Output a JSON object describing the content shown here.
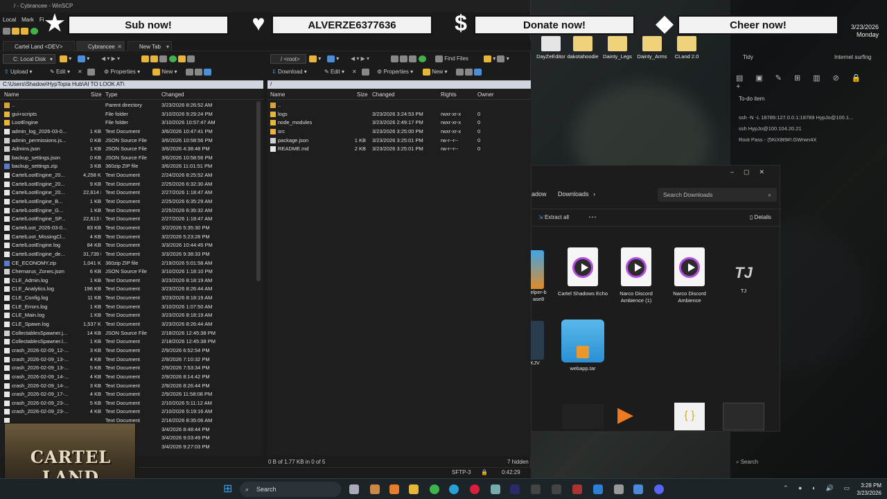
{
  "winscp": {
    "title": "/ - Cybrancee - WinSCP",
    "menu": [
      "Local",
      "Mark",
      "Fi"
    ],
    "tabs": [
      {
        "label": "Cartel Land <DEV>"
      },
      {
        "label": "Cybrancee"
      },
      {
        "label": "New Tab"
      }
    ],
    "local": {
      "drive": "C: Local Disk",
      "toolbar": {
        "upload": "Upload",
        "edit": "Edit",
        "properties": "Properties",
        "new": "New"
      },
      "path": "C:\\Users\\Shadow\\HypTopia Hub\\AI TO LOOK AT\\",
      "columns": {
        "name": "Name",
        "size": "Size",
        "type": "Type",
        "changed": "Changed"
      },
      "rows": [
        {
          "name": "..",
          "size": "",
          "type": "Parent directory",
          "changed": "3/23/2026 8:26:52 AM",
          "icon": "up"
        },
        {
          "name": "gui+scripts",
          "size": "",
          "type": "File folder",
          "changed": "3/10/2026 9:29:24 PM",
          "icon": "folder"
        },
        {
          "name": "LootEngine",
          "size": "",
          "type": "File folder",
          "changed": "3/10/2026 10:57:47 AM",
          "icon": "folder"
        },
        {
          "name": "admin_log_2026-03-0...",
          "size": "1 KB",
          "type": "Text Document",
          "changed": "3/6/2026 10:47:41 PM",
          "icon": "doc"
        },
        {
          "name": "admin_permissions.js...",
          "size": "0 KB",
          "type": "JSON Source File",
          "changed": "3/6/2026 10:58:56 PM",
          "icon": "json"
        },
        {
          "name": "Admins.json",
          "size": "1 KB",
          "type": "JSON Source File",
          "changed": "3/6/2026 4:38:48 PM",
          "icon": "json"
        },
        {
          "name": "backup_settings.json",
          "size": "0 KB",
          "type": "JSON Source File",
          "changed": "3/6/2026 10:58:56 PM",
          "icon": "json"
        },
        {
          "name": "backup_settings.zip",
          "size": "3 KB",
          "type": "360zip ZIP file",
          "changed": "3/6/2026 11:01:51 PM",
          "icon": "zip"
        },
        {
          "name": "CartelLootEngine_20...",
          "size": "4,258 KB",
          "type": "Text Document",
          "changed": "2/24/2026 8:25:52 AM",
          "icon": "doc"
        },
        {
          "name": "CartelLootEngine_20...",
          "size": "9 KB",
          "type": "Text Document",
          "changed": "2/25/2026 6:32:30 AM",
          "icon": "doc"
        },
        {
          "name": "CartelLootEngine_20...",
          "size": "22,614 KB",
          "type": "Text Document",
          "changed": "2/27/2026 1:18:47 AM",
          "icon": "doc"
        },
        {
          "name": "CartelLootEngine_B...",
          "size": "1 KB",
          "type": "Text Document",
          "changed": "2/25/2026 6:35:29 AM",
          "icon": "doc"
        },
        {
          "name": "CartelLootEngine_G...",
          "size": "1 KB",
          "type": "Text Document",
          "changed": "2/25/2026 6:35:32 AM",
          "icon": "doc"
        },
        {
          "name": "CartelLootEngine_SP...",
          "size": "22,613 KB",
          "type": "Text Document",
          "changed": "2/27/2026 1:18:47 AM",
          "icon": "doc"
        },
        {
          "name": "CartelLoot_2026-03-0...",
          "size": "83 KB",
          "type": "Text Document",
          "changed": "3/2/2026 5:35:30 PM",
          "icon": "doc"
        },
        {
          "name": "CartelLoot_MissingCl...",
          "size": "4 KB",
          "type": "Text Document",
          "changed": "3/2/2026 5:23:28 PM",
          "icon": "doc"
        },
        {
          "name": "CartelLootEngine.log",
          "size": "84 KB",
          "type": "Text Document",
          "changed": "3/3/2026 10:44:45 PM",
          "icon": "doc"
        },
        {
          "name": "CartelLootEngine_de...",
          "size": "31,739 KB",
          "type": "Text Document",
          "changed": "3/3/2026 9:38:33 PM",
          "icon": "doc"
        },
        {
          "name": "CE_ECONOMY.zip",
          "size": "1,041 KB",
          "type": "360zip ZIP file",
          "changed": "2/19/2026 5:01:58 AM",
          "icon": "zip"
        },
        {
          "name": "Chernarus_Zones.json",
          "size": "6 KB",
          "type": "JSON Source File",
          "changed": "3/10/2026 1:18:10 PM",
          "icon": "json"
        },
        {
          "name": "CLE_Admin.log",
          "size": "1 KB",
          "type": "Text Document",
          "changed": "3/23/2026 8:18:19 AM",
          "icon": "doc"
        },
        {
          "name": "CLE_Analytics.log",
          "size": "196 KB",
          "type": "Text Document",
          "changed": "3/23/2026 8:26:44 AM",
          "icon": "doc"
        },
        {
          "name": "CLE_Config.log",
          "size": "11 KB",
          "type": "Text Document",
          "changed": "3/23/2026 8:18:19 AM",
          "icon": "doc"
        },
        {
          "name": "CLE_Errors.log",
          "size": "1 KB",
          "type": "Text Document",
          "changed": "3/10/2026 1:07:50 AM",
          "icon": "doc"
        },
        {
          "name": "CLE_Main.log",
          "size": "1 KB",
          "type": "Text Document",
          "changed": "3/23/2026 8:18:19 AM",
          "icon": "doc"
        },
        {
          "name": "CLE_Spawn.log",
          "size": "1,537 KB",
          "type": "Text Document",
          "changed": "3/23/2026 8:26:44 AM",
          "icon": "doc"
        },
        {
          "name": "CollectablesSpawner.j...",
          "size": "14 KB",
          "type": "JSON Source File",
          "changed": "2/18/2026 12:45:38 PM",
          "icon": "json"
        },
        {
          "name": "CollectablesSpawner.l...",
          "size": "1 KB",
          "type": "Text Document",
          "changed": "2/18/2026 12:45:38 PM",
          "icon": "doc"
        },
        {
          "name": "crash_2026-02-09_12-...",
          "size": "3 KB",
          "type": "Text Document",
          "changed": "2/9/2026 6:52:54 PM",
          "icon": "doc"
        },
        {
          "name": "crash_2026-02-09_13-...",
          "size": "4 KB",
          "type": "Text Document",
          "changed": "2/9/2026 7:10:32 PM",
          "icon": "doc"
        },
        {
          "name": "crash_2026-02-09_13-...",
          "size": "5 KB",
          "type": "Text Document",
          "changed": "2/9/2026 7:53:34 PM",
          "icon": "doc"
        },
        {
          "name": "crash_2026-02-09_14-...",
          "size": "4 KB",
          "type": "Text Document",
          "changed": "2/9/2026 8:14:42 PM",
          "icon": "doc"
        },
        {
          "name": "crash_2026-02-09_14-...",
          "size": "3 KB",
          "type": "Text Document",
          "changed": "2/9/2026 8:26:44 PM",
          "icon": "doc"
        },
        {
          "name": "crash_2026-02-09_17-...",
          "size": "4 KB",
          "type": "Text Document",
          "changed": "2/9/2026 11:58:08 PM",
          "icon": "doc"
        },
        {
          "name": "crash_2026-02-09_23-...",
          "size": "5 KB",
          "type": "Text Document",
          "changed": "2/10/2026 5:11:12 AM",
          "icon": "doc"
        },
        {
          "name": "crash_2026-02-09_23-...",
          "size": "4 KB",
          "type": "Text Document",
          "changed": "2/10/2026 5:19:16 AM",
          "icon": "doc"
        },
        {
          "name": "",
          "size": "",
          "type": "Text Document",
          "changed": "2/16/2026 8:35:06 AM",
          "icon": "doc"
        },
        {
          "name": "",
          "size": "",
          "type": "",
          "changed": "3/4/2026 8:48:44 PM",
          "icon": "doc"
        },
        {
          "name": "",
          "size": "",
          "type": "",
          "changed": "3/4/2026 9:03:49 PM",
          "icon": "doc"
        },
        {
          "name": "",
          "size": "",
          "type": "",
          "changed": "3/4/2026 9:27:03 PM",
          "icon": "doc"
        }
      ]
    },
    "remote": {
      "root": "/ <root>",
      "toolbar": {
        "download": "Download",
        "edit": "Edit",
        "properties": "Properties",
        "new": "New",
        "find": "Find Files"
      },
      "path": "/",
      "columns": {
        "name": "Name",
        "size": "Size",
        "changed": "Changed",
        "rights": "Rights",
        "owner": "Owner"
      },
      "rows": [
        {
          "name": "..",
          "size": "",
          "changed": "",
          "rights": "",
          "owner": "",
          "icon": "up"
        },
        {
          "name": "logs",
          "size": "",
          "changed": "3/23/2026 3:24:53 PM",
          "rights": "rwxr-xr-x",
          "owner": "0",
          "icon": "folder"
        },
        {
          "name": "node_modules",
          "size": "",
          "changed": "3/23/2026 2:49:17 PM",
          "rights": "rwxr-xr-x",
          "owner": "0",
          "icon": "folder"
        },
        {
          "name": "src",
          "size": "",
          "changed": "3/23/2026 3:25:00 PM",
          "rights": "rwxr-xr-x",
          "owner": "0",
          "icon": "folder"
        },
        {
          "name": "package.json",
          "size": "1 KB",
          "changed": "3/23/2026 3:25:01 PM",
          "rights": "rw-r--r--",
          "owner": "0",
          "icon": "json"
        },
        {
          "name": "README.md",
          "size": "2 KB",
          "changed": "3/23/2026 3:25:01 PM",
          "rights": "rw-r--r--",
          "owner": "0",
          "icon": "doc"
        }
      ],
      "status_left": "0 B of 1.77 KB in 0 of 5",
      "status_right": "7 hidden",
      "protocol": "SFTP-3",
      "time": "0:42:29"
    }
  },
  "banners": [
    {
      "label": "Sub now!",
      "icon": "star-icon",
      "glyph": "★"
    },
    {
      "label": "ALVERZE6377636",
      "icon": "heart-icon",
      "glyph": "♥"
    },
    {
      "label": "Donate now!",
      "icon": "dollar-icon",
      "glyph": "$"
    },
    {
      "label": "Cheer now!",
      "icon": "diamond-icon",
      "glyph": "◆"
    }
  ],
  "desktop": {
    "icons": [
      "DayZeEditor",
      "dakotahoodie",
      "Dainty_Legs",
      "Dainty_Arms",
      "CLand 2.0"
    ],
    "organizer": {
      "date": "3/23/2026",
      "day": "Monday",
      "tidy": "Tidy",
      "internet": "Internet surfing",
      "todo": "To-do item",
      "notes": [
        "ssh -N -L 18789:127.0.0.1:18789 HypJo@100.1...",
        "ssh HypJo@100.104.20.21",
        "Root Pass - (5KiX8t9#!.GWrwn4X"
      ]
    }
  },
  "explorer": {
    "breadcrumb": [
      "adow",
      "Downloads"
    ],
    "search_placeholder": "Search Downloads",
    "extract": "Extract all",
    "details": "Details",
    "items": [
      {
        "label": "elper-b ase8",
        "kind": "zip"
      },
      {
        "label": "Cartel Shadows Echo",
        "kind": "media"
      },
      {
        "label": "Narco Discord Ambience (1)",
        "kind": "media"
      },
      {
        "label": "Narco Discord Ambience",
        "kind": "media"
      },
      {
        "label": "TJ",
        "kind": "logo"
      },
      {
        "label": "OKJV",
        "kind": "other"
      },
      {
        "label": "webapp.tar",
        "kind": "zip"
      }
    ]
  },
  "taskbar": {
    "search": "Search",
    "time": "3:28 PM",
    "date": "3/23/2026"
  },
  "webcam": {
    "logo": "CARTEL LAND"
  }
}
